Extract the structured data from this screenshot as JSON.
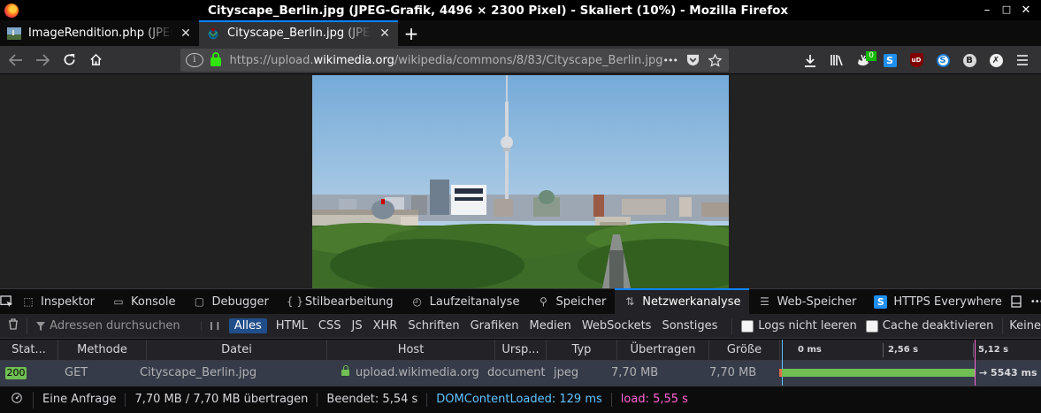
{
  "window": {
    "title": "Cityscape_Berlin.jpg (JPEG-Grafik, 4496 × 2300 Pixel) - Skaliert (10%) - Mozilla Firefox",
    "min": "–",
    "max": "□",
    "close": "✕"
  },
  "tabs": [
    {
      "label": "ImageRendition.php (JPEG-",
      "close": "✕"
    },
    {
      "label": "Cityscape_Berlin.jpg (JPEG-",
      "close": "✕"
    }
  ],
  "newtab": "+",
  "urlbar": {
    "url_prefix": "https://upload.",
    "url_domain": "wikimedia.org",
    "url_path": "/wikipedia/commons/8/83/Cityscape_Berlin.jpg",
    "more": "•••"
  },
  "toolbar": {
    "badge_count": "0"
  },
  "devtools": {
    "tabs": [
      {
        "label": "Inspektor",
        "icon": "⬚"
      },
      {
        "label": "Konsole",
        "icon": "▭"
      },
      {
        "label": "Debugger",
        "icon": "▢"
      },
      {
        "label": "Stilbearbeitung",
        "icon": "{ }"
      },
      {
        "label": "Laufzeitanalyse",
        "icon": "◴"
      },
      {
        "label": "Speicher",
        "icon": "⚲"
      },
      {
        "label": "Netzwerkanalyse",
        "icon": "⇅"
      },
      {
        "label": "Web-Speicher",
        "icon": "☰"
      },
      {
        "label": "HTTPS Everywhere",
        "icon": "S"
      }
    ],
    "more": "•••",
    "close": "✕"
  },
  "filter": {
    "search_placeholder": "Adressen durchsuchen",
    "pause": "❙❙",
    "types": [
      "Alles",
      "HTML",
      "CSS",
      "JS",
      "XHR",
      "Schriften",
      "Grafiken",
      "Medien",
      "WebSockets",
      "Sonstiges"
    ],
    "persist_logs": "Logs nicht leeren",
    "disable_cache": "Cache deaktivieren",
    "throttling": "Keine"
  },
  "columns": [
    "Stat...",
    "Methode",
    "Datei",
    "Host",
    "Ursp...",
    "Typ",
    "Übertragen",
    "Größe"
  ],
  "timeline_labels": [
    "0 ms",
    "2,56 s",
    "5,12 s"
  ],
  "request": {
    "status": "200",
    "method": "GET",
    "file": "Cityscape_Berlin.jpg",
    "host": "upload.wikimedia.org",
    "cause": "document",
    "type": "jpeg",
    "transferred": "7,70 MB",
    "size": "7,70 MB",
    "duration": "→ 5543 ms"
  },
  "summary": {
    "requests": "Eine Anfrage",
    "transfer": "7,70 MB / 7,70 MB übertragen",
    "finished": "Beendet: 5,54 s",
    "dcl": "DOMContentLoaded: 129 ms",
    "load": "load: 5,55 s"
  },
  "colors": {
    "accent": "#0a84ff",
    "status_ok": "#70bf53",
    "dcl": "#5fc4ff",
    "load": "#ff64d7"
  }
}
